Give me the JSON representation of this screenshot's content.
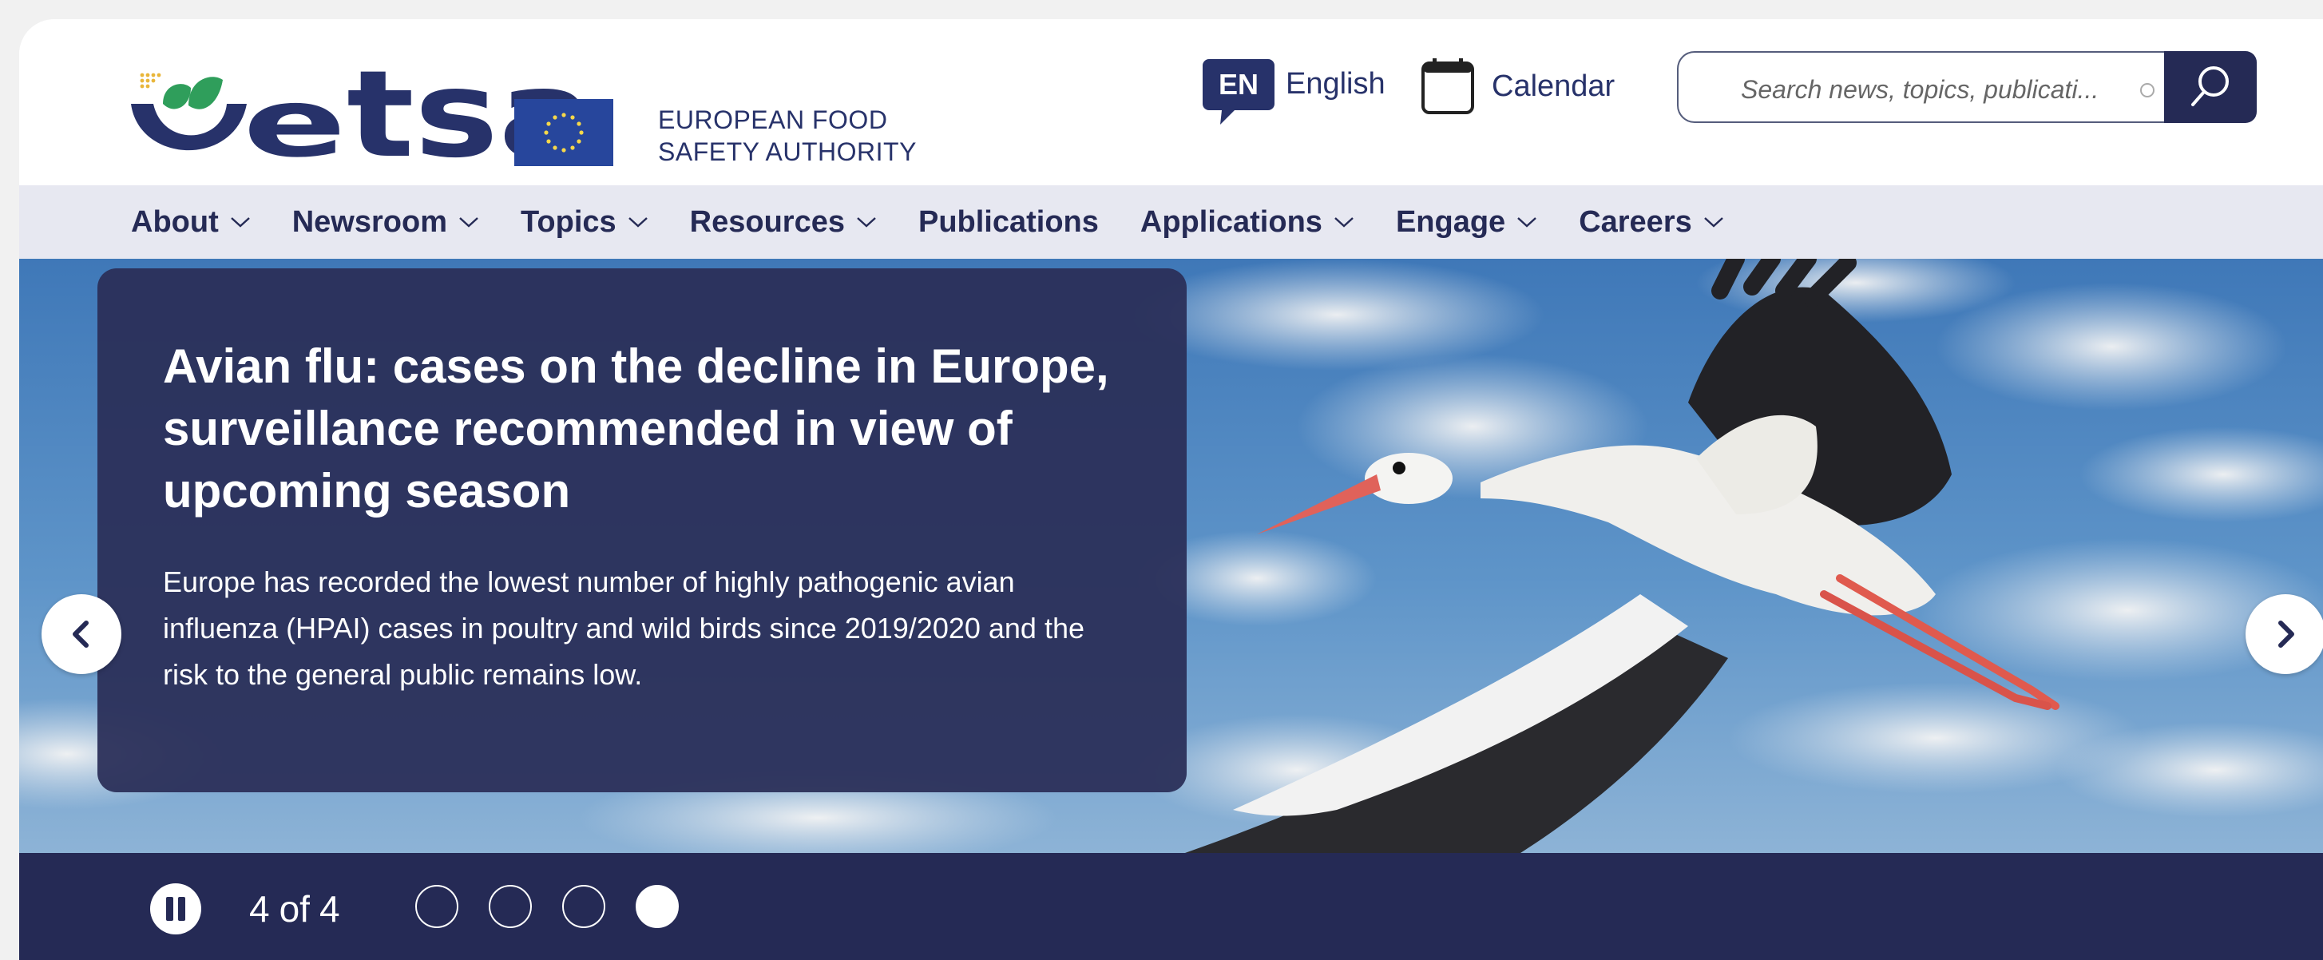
{
  "header": {
    "logo": {
      "wordmark": "efsa",
      "line1": "EUROPEAN FOOD",
      "line2": "SAFETY AUTHORITY"
    },
    "language": {
      "code": "EN",
      "label": "English"
    },
    "calendar": {
      "label": "Calendar",
      "icon": "calendar-icon"
    },
    "search": {
      "placeholder": "Search news, topics, publicati...",
      "icon": "search-icon"
    }
  },
  "nav": {
    "items": [
      {
        "label": "About",
        "has_dropdown": true
      },
      {
        "label": "Newsroom",
        "has_dropdown": true
      },
      {
        "label": "Topics",
        "has_dropdown": true
      },
      {
        "label": "Resources",
        "has_dropdown": true
      },
      {
        "label": "Publications",
        "has_dropdown": false
      },
      {
        "label": "Applications",
        "has_dropdown": true
      },
      {
        "label": "Engage",
        "has_dropdown": true
      },
      {
        "label": "Careers",
        "has_dropdown": true
      }
    ]
  },
  "hero": {
    "title": "Avian flu: cases on the decline in Europe, surveillance recommended in view of upcoming season",
    "body": "Europe has recorded the lowest number of highly pathogenic avian influenza (HPAI) cases in poultry and wild birds since 2019/2020 and the risk to the general public remains low.",
    "prev_icon": "chevron-left-icon",
    "next_icon": "chevron-right-icon"
  },
  "carousel": {
    "current": "4",
    "of_label": "of",
    "total": "4",
    "slides": 4,
    "active_index": 3
  },
  "colors": {
    "brand_navy": "#252a55",
    "card_bg": "#2a2f58",
    "nav_bg": "#e7e8f1",
    "logo_green": "#2f9e5b",
    "logo_blue": "#27326a"
  }
}
